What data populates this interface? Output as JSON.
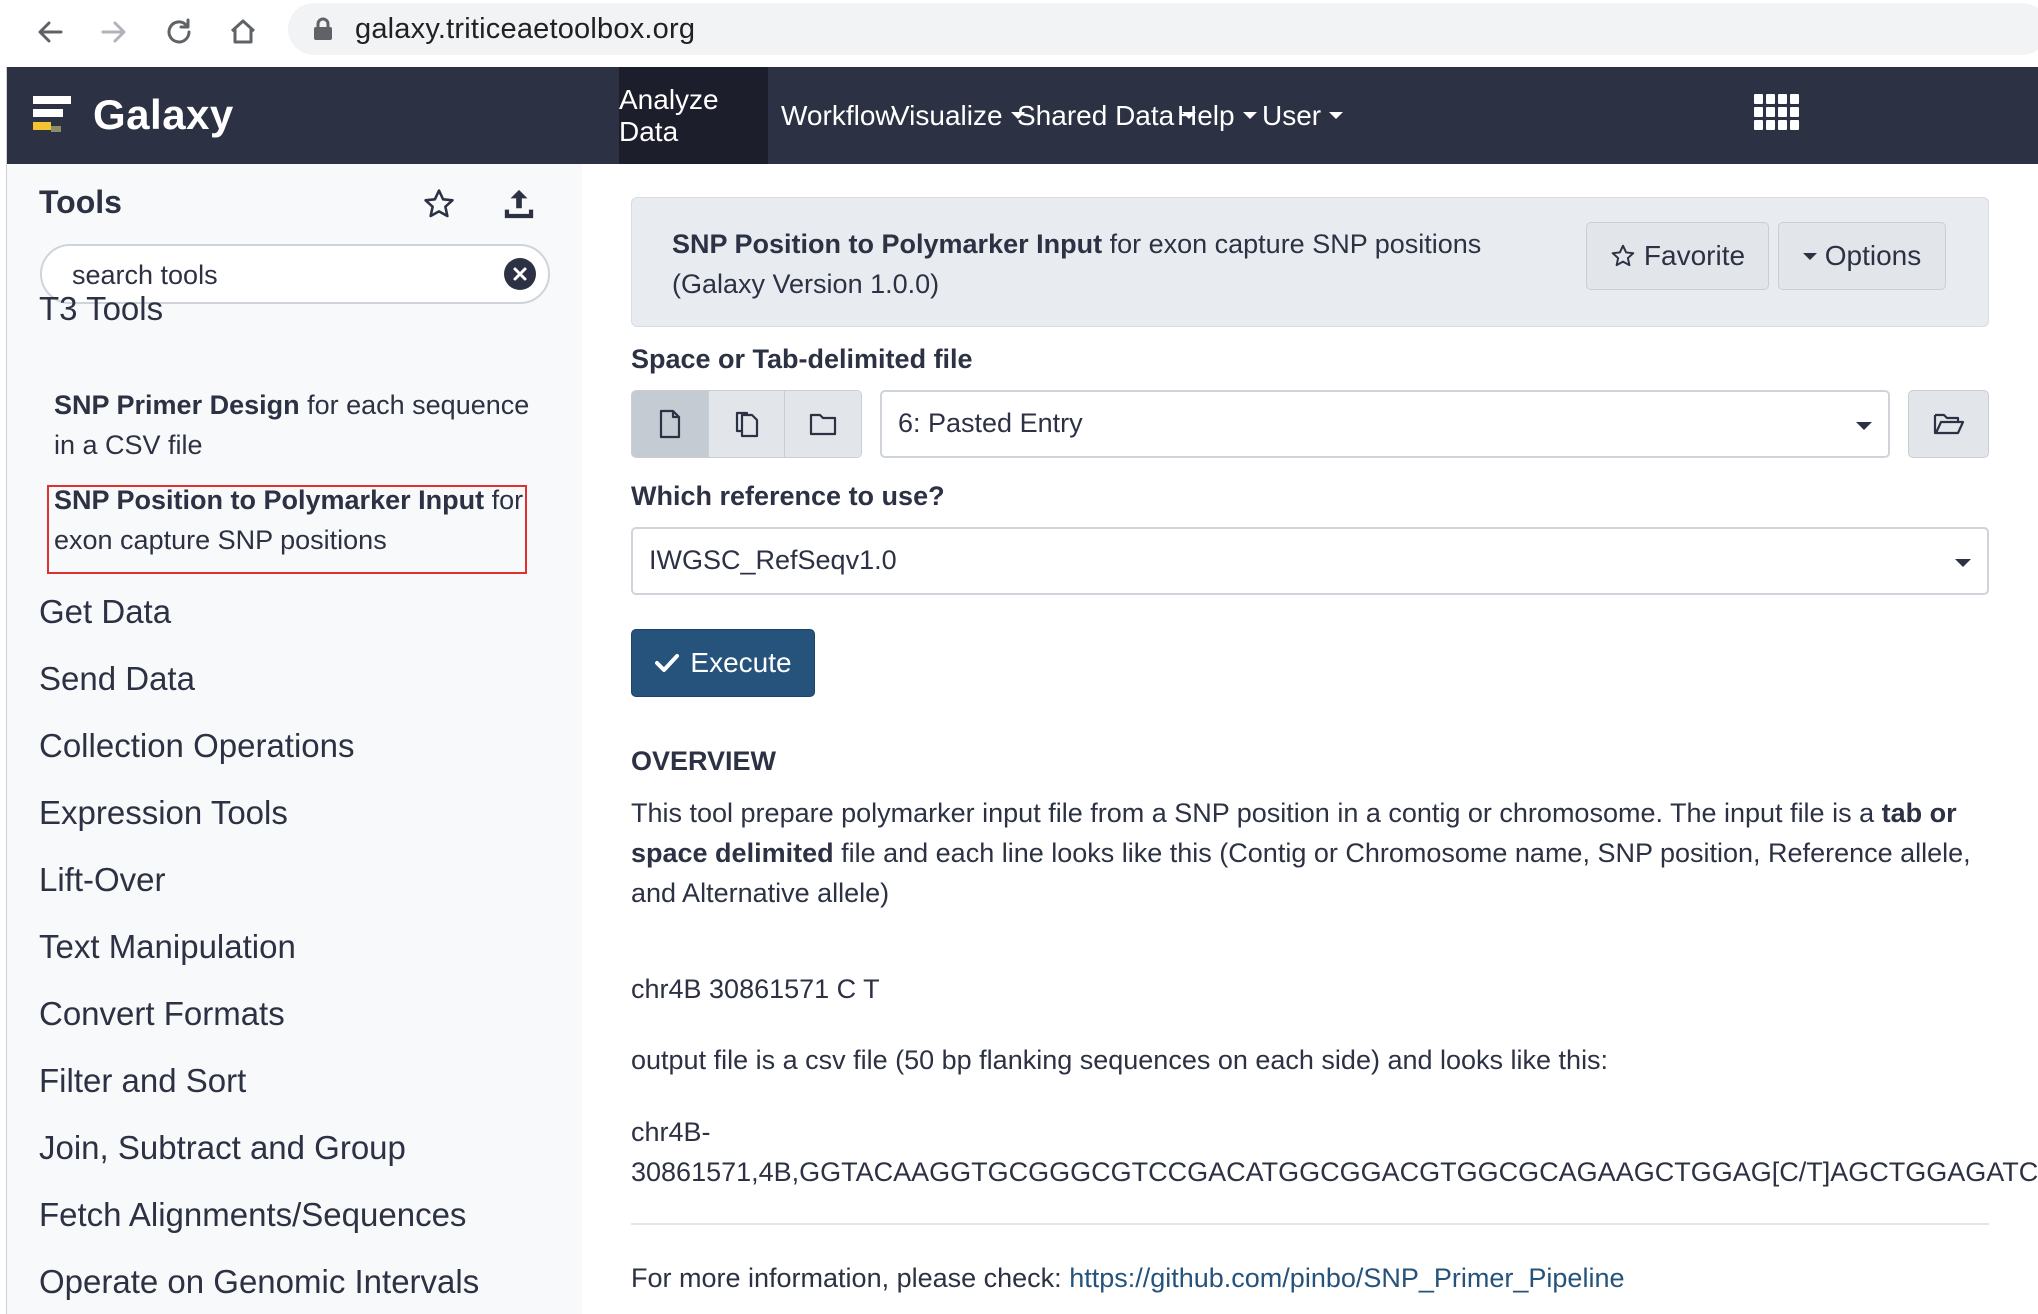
{
  "browser": {
    "url": "galaxy.triticeaetoolbox.org"
  },
  "masthead": {
    "brand": "Galaxy",
    "nav": [
      {
        "label": "Analyze Data",
        "active": true
      },
      {
        "label": "Workflow"
      },
      {
        "label": "Visualize",
        "dropdown": true
      },
      {
        "label": "Shared Data",
        "dropdown": true
      },
      {
        "label": "Help",
        "dropdown": true
      },
      {
        "label": "User",
        "dropdown": true
      }
    ]
  },
  "tool_panel": {
    "title": "Tools",
    "search_placeholder": "search tools",
    "t3_section": "T3 Tools",
    "tools": [
      {
        "name": "SNP Primer Design",
        "desc_line1": " for each sequence",
        "desc_line2": "in a CSV file"
      },
      {
        "name": "SNP Position to Polymarker Input",
        "desc_line1": " for",
        "desc_line2": "exon capture SNP positions"
      }
    ],
    "sections": [
      "Get Data",
      "Send Data",
      "Collection Operations",
      "Expression Tools",
      "Lift-Over",
      "Text Manipulation",
      "Convert Formats",
      "Filter and Sort",
      "Join, Subtract and Group",
      "Fetch Alignments/Sequences",
      "Operate on Genomic Intervals"
    ]
  },
  "tool_form": {
    "name": "SNP Position to Polymarker Input",
    "desc": " for exon capture SNP positions",
    "version": "(Galaxy Version 1.0.0)",
    "favorite_label": "Favorite",
    "options_label": "Options",
    "input1_label": "Space or Tab-delimited file",
    "input1_value": "6: Pasted Entry",
    "input2_label": "Which reference to use?",
    "input2_value": "IWGSC_RefSeqv1.0",
    "execute_label": "Execute"
  },
  "help": {
    "overview_title": "OVERVIEW",
    "p1_a": "This tool prepare polymarker input file from a SNP position in a contig or chromosome. The input file is a ",
    "p1_b": "tab or",
    "p1_c": "space delimited",
    "p1_d": " file and each line looks like this (Contig or Chromosome name, SNP position, Reference allele,",
    "p1_e": "and Alternative allele)",
    "example_input": "chr4B 30861571 C T",
    "p2": "output file is a csv file (50 bp flanking sequences on each side) and looks like this:",
    "example_out_1": "chr4B-",
    "example_out_2": "30861571,4B,GGTACAAGGTGCGGGCGTCCGACATGGCGGACGTGGCGCAGAAGCTGGAG[C/T]AGCTGGAGATC",
    "more_info_prefix": "For more information, please check: ",
    "more_info_link": "https://github.com/pinbo/SNP_Primer_Pipeline"
  }
}
